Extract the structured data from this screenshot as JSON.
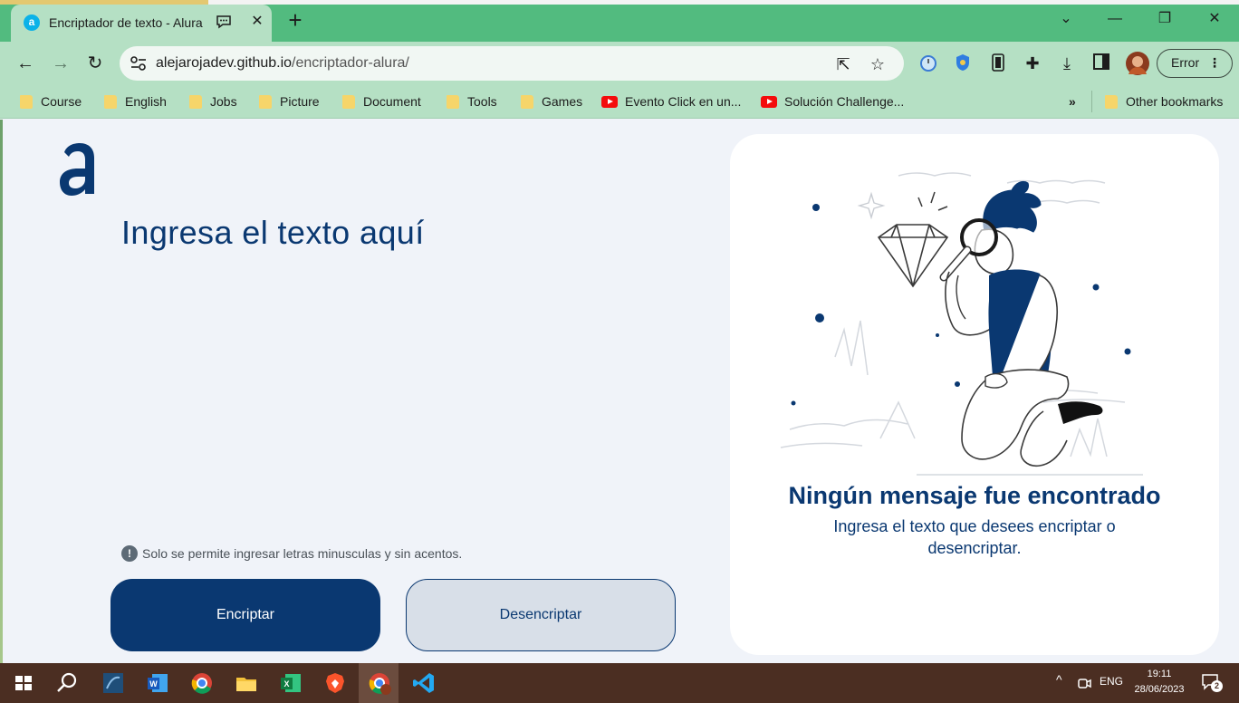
{
  "browser": {
    "tab": {
      "title": "Encriptador de texto - Alura",
      "favicon_letter": "a"
    },
    "address": {
      "domain": "alejarojadev.github.io",
      "path": "/encriptador-alura/"
    },
    "profile_button": "Error",
    "bookmarks": [
      {
        "label": "Course",
        "icon": "folder-icon"
      },
      {
        "label": "English",
        "icon": "folder-icon"
      },
      {
        "label": "Jobs",
        "icon": "folder-icon"
      },
      {
        "label": "Picture",
        "icon": "folder-icon"
      },
      {
        "label": "Document",
        "icon": "folder-icon"
      },
      {
        "label": "Tools",
        "icon": "folder-icon"
      },
      {
        "label": "Games",
        "icon": "folder-icon"
      },
      {
        "label": "Evento Click en un...",
        "icon": "youtube-icon"
      },
      {
        "label": "Solución Challenge...",
        "icon": "youtube-icon"
      }
    ],
    "more_bookmarks": "»",
    "other_bookmarks": "Other bookmarks"
  },
  "app": {
    "heading": "Ingresa el texto aquí",
    "hint": "Solo se permite ingresar letras minusculas y sin acentos.",
    "encrypt_button": "Encriptar",
    "decrypt_button": "Desencriptar",
    "result": {
      "title": "Ningún mensaje fue encontrado",
      "subtitle": "Ingresa el texto que desees encriptar o desencriptar."
    }
  },
  "taskbar": {
    "language": "ENG",
    "time": "19:11",
    "date": "28/06/2023",
    "notifications": "2"
  },
  "colors": {
    "brand": "#0a3871",
    "tab_strip": "#52bb7f",
    "toolbar": "#b5e0c4",
    "page_bg": "#f0f3f9"
  }
}
